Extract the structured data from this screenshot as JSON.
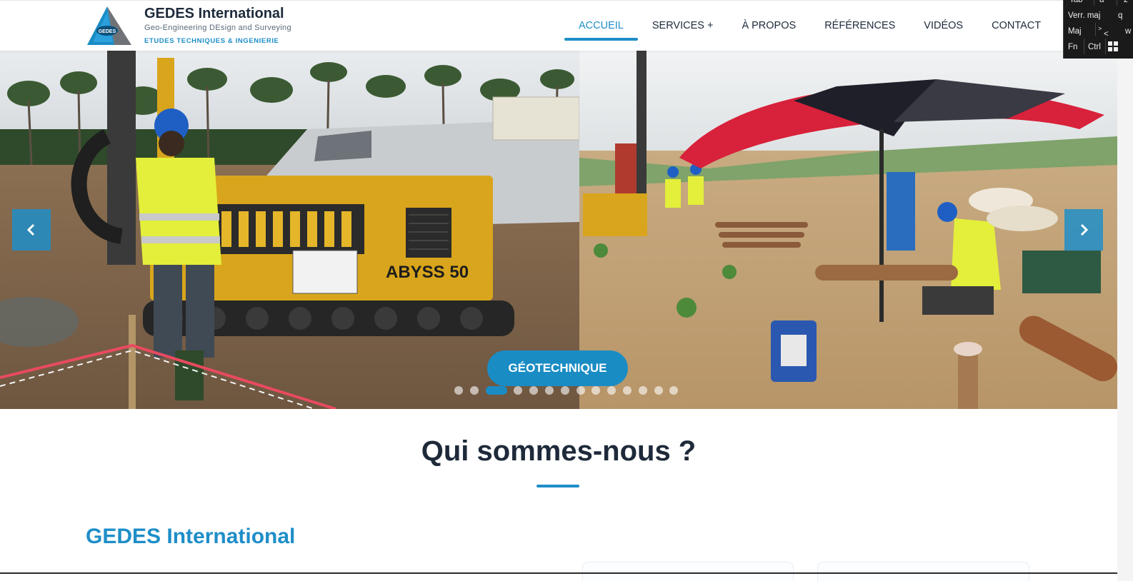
{
  "header": {
    "brand_title": "GEDES International",
    "brand_subtitle": "Geo-Engineering DEsign and Surveying",
    "brand_tagline": "ETUDES TECHNIQUES & INGENIERIE",
    "logo_text": "GEDES"
  },
  "nav": {
    "items": [
      {
        "label": "ACCUEIL",
        "active": true
      },
      {
        "label": "SERVICES +",
        "active": false
      },
      {
        "label": "À PROPOS",
        "active": false
      },
      {
        "label": "RÉFÉRENCES",
        "active": false
      },
      {
        "label": "VIDÉOS",
        "active": false
      },
      {
        "label": "CONTACT",
        "active": false
      }
    ]
  },
  "keyboard": {
    "row1": [
      "Tab",
      "a",
      "z"
    ],
    "row2": [
      "Verr. maj",
      "q"
    ],
    "row3": [
      "Maj",
      ">",
      "<",
      "w"
    ],
    "row4": [
      "Fn",
      "Ctrl"
    ]
  },
  "slider": {
    "caption": "GÉOTECHNIQUE",
    "slide_count": 14,
    "active_slide": 3,
    "machine_label": "ABYSS 50",
    "prev_icon": "chevron-left-icon",
    "next_icon": "chevron-right-icon"
  },
  "main": {
    "section_title": "Qui sommes-nous ?",
    "company_heading": "GEDES International"
  },
  "colors": {
    "accent": "#1e8ec8",
    "dark": "#1e2a3a"
  }
}
